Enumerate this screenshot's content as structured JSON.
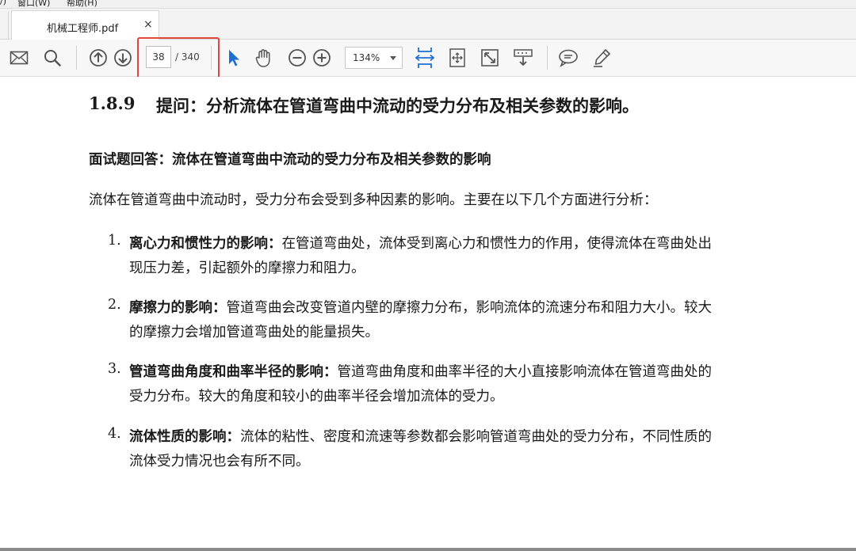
{
  "menubar": {
    "items": [
      "/)",
      "窗口(W)",
      "帮助(H)"
    ]
  },
  "tab": {
    "title": "机械工程师.pdf",
    "close": "×"
  },
  "toolbar": {
    "page_current": "38",
    "page_total": "/ 340",
    "zoom": "134%"
  },
  "colors": {
    "highlight": "#e0453e",
    "accent_blue": "#1f6fd1"
  },
  "document": {
    "heading_num": "1.8.9",
    "heading_text": "提问：分析流体在管道弯曲中流动的受力分布及相关参数的影响。",
    "subheading": "面试题回答：流体在管道弯曲中流动的受力分布及相关参数的影响",
    "intro": "流体在管道弯曲中流动时，受力分布会受到多种因素的影响。主要在以下几个方面进行分析：",
    "items": [
      {
        "num": "1.",
        "bold": "离心力和惯性力的影响：",
        "line1": "在管道弯曲处，流体受到离心力和惯性力的作用，使得流体在弯曲处出",
        "line2": "现压力差，引起额外的摩擦力和阻力。"
      },
      {
        "num": "2.",
        "bold": "摩擦力的影响：",
        "line1": "管道弯曲会改变管道内壁的摩擦力分布，影响流体的流速分布和阻力大小。较大",
        "line2": "的摩擦力会增加管道弯曲处的能量损失。"
      },
      {
        "num": "3.",
        "bold": "管道弯曲角度和曲率半径的影响：",
        "line1": "管道弯曲角度和曲率半径的大小直接影响流体在管道弯曲处的",
        "line2": "受力分布。较大的角度和较小的曲率半径会增加流体的受力。"
      },
      {
        "num": "4.",
        "bold": "流体性质的影响：",
        "line1": "流体的粘性、密度和流速等参数都会影响管道弯曲处的受力分布，不同性质的",
        "line2": "流体受力情况也会有所不同。"
      }
    ]
  },
  "icons": [
    "email-icon",
    "search-icon",
    "page-up-icon",
    "page-down-icon",
    "select-arrow-icon",
    "hand-icon",
    "zoom-out-icon",
    "zoom-in-icon",
    "fit-width-icon",
    "marquee-zoom-icon",
    "fullscreen-icon",
    "scroll-mode-icon",
    "comment-icon",
    "highlight-pen-icon"
  ]
}
